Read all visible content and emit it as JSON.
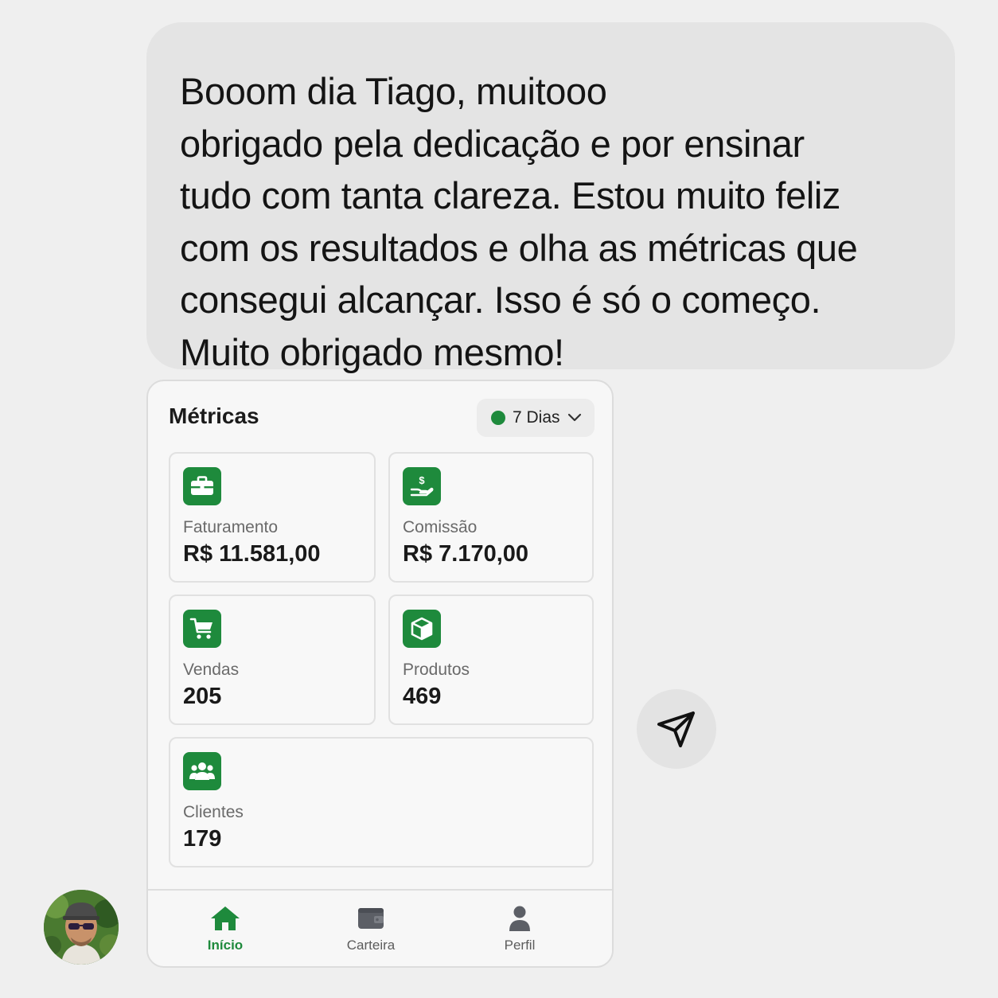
{
  "message": {
    "text": "Booom dia Tiago, muitooo\nobrigado pela dedicação e por ensinar\ntudo com tanta clareza. Estou muito feliz\ncom os resultados e olha as métricas que\nconsegui alcançar. Isso é só o começo.\nMuito obrigado mesmo!"
  },
  "card": {
    "title": "Métricas",
    "period": {
      "label": "7 Dias",
      "status_color": "#1e8a3c"
    }
  },
  "metrics": [
    {
      "label": "Faturamento",
      "value": "R$ 11.581,00",
      "icon": "briefcase-icon"
    },
    {
      "label": "Comissão",
      "value": "R$ 7.170,00",
      "icon": "money-hand-icon"
    },
    {
      "label": "Vendas",
      "value": "205",
      "icon": "cart-icon"
    },
    {
      "label": "Produtos",
      "value": "469",
      "icon": "box-icon"
    },
    {
      "label": "Clientes",
      "value": "179",
      "icon": "users-icon"
    }
  ],
  "nav": [
    {
      "label": "Início",
      "icon": "home-icon",
      "active": true
    },
    {
      "label": "Carteira",
      "icon": "wallet-icon",
      "active": false
    },
    {
      "label": "Perfil",
      "icon": "user-icon",
      "active": false
    }
  ],
  "colors": {
    "accent": "#1e8a3c",
    "bubble": "#e4e4e4",
    "background": "#efefef"
  },
  "send": {
    "icon": "send-icon"
  }
}
